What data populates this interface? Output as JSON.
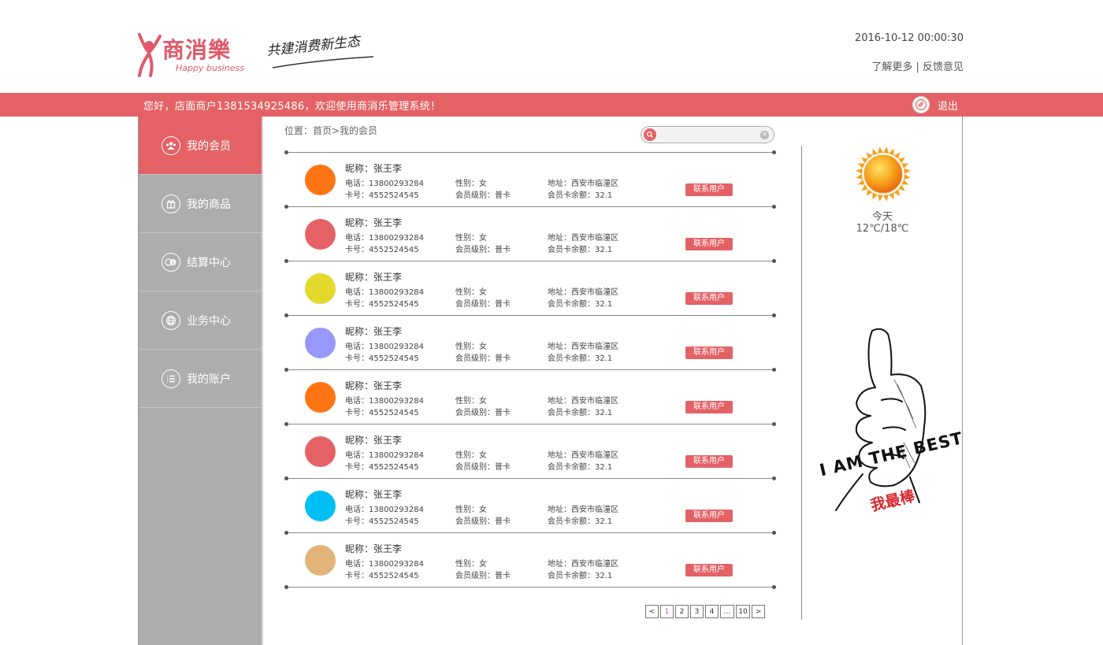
{
  "header": {
    "logo_text": "商消樂",
    "logo_subtext": "Happy business",
    "slogan": "共建消费新生态",
    "datetime": "2016-10-12 00:00:30",
    "link_more": "了解更多",
    "link_sep": " | ",
    "link_feedback": "反馈意见"
  },
  "topbar": {
    "welcome": "您好，店面商户13815349254​86，欢迎使用商消乐管理系统！",
    "logout": "退出"
  },
  "sidebar": {
    "items": [
      {
        "label": "我的会员",
        "icon": "members-icon",
        "active": true
      },
      {
        "label": "我的商品",
        "icon": "gift-icon",
        "active": false
      },
      {
        "label": "结算中心",
        "icon": "coins-icon",
        "active": false
      },
      {
        "label": "业务中心",
        "icon": "globe-icon",
        "active": false
      },
      {
        "label": "我的账户",
        "icon": "list-icon",
        "active": false
      }
    ]
  },
  "breadcrumb": "位置：首页>我的会员",
  "search": {
    "placeholder": "",
    "value": ""
  },
  "members": [
    {
      "color": "#ff7514",
      "nick": "昵称：张王李",
      "phone": "电话：13800293284",
      "card": "卡号：4552524545",
      "gender": "性别：女",
      "level": "会员级别：普卡",
      "address": "地址：西安市临潼区",
      "balance": "会员卡余额：32.1",
      "action": "联系用户"
    },
    {
      "color": "#e46266",
      "nick": "昵称：张王李",
      "phone": "电话：13800293284",
      "card": "卡号：4552524545",
      "gender": "性别：女",
      "level": "会员级别：普卡",
      "address": "地址：西安市临潼区",
      "balance": "会员卡余额：32.1",
      "action": "联系用户"
    },
    {
      "color": "#e3d92d",
      "nick": "昵称：张王李",
      "phone": "电话：13800293284",
      "card": "卡号：4552524545",
      "gender": "性别：女",
      "level": "会员级别：普卡",
      "address": "地址：西安市临潼区",
      "balance": "会员卡余额：32.1",
      "action": "联系用户"
    },
    {
      "color": "#9898fb",
      "nick": "昵称：张王李",
      "phone": "电话：13800293284",
      "card": "卡号：4552524545",
      "gender": "性别：女",
      "level": "会员级别：普卡",
      "address": "地址：西安市临潼区",
      "balance": "会员卡余额：32.1",
      "action": "联系用户"
    },
    {
      "color": "#ff7514",
      "nick": "昵称：张王李",
      "phone": "电话：13800293284",
      "card": "卡号：4552524545",
      "gender": "性别：女",
      "level": "会员级别：普卡",
      "address": "地址：西安市临潼区",
      "balance": "会员卡余额：32.1",
      "action": "联系用户"
    },
    {
      "color": "#e46266",
      "nick": "昵称：张王李",
      "phone": "电话：13800293284",
      "card": "卡号：4552524545",
      "gender": "性别：女",
      "level": "会员级别：普卡",
      "address": "地址：西安市临潼区",
      "balance": "会员卡余额：32.1",
      "action": "联系用户"
    },
    {
      "color": "#00bff5",
      "nick": "昵称：张王李",
      "phone": "电话：13800293284",
      "card": "卡号：4552524545",
      "gender": "性别：女",
      "level": "会员级别：普卡",
      "address": "地址：西安市临潼区",
      "balance": "会员卡余额：32.1",
      "action": "联系用户"
    },
    {
      "color": "#e1b57a",
      "nick": "昵称：张王李",
      "phone": "电话：13800293284",
      "card": "卡号：4552524545",
      "gender": "性别：女",
      "level": "会员级别：普卡",
      "address": "地址：西安市临潼区",
      "balance": "会员卡余额：32.1",
      "action": "联系用户"
    }
  ],
  "pager": {
    "prev": "<",
    "pages": [
      "1",
      "2",
      "3",
      "4",
      "...",
      "10"
    ],
    "current": "1",
    "next": ">"
  },
  "weather": {
    "label": "今天",
    "temp": "12℃/18℃",
    "icon": "sun-icon"
  },
  "promo": {
    "en": "I AM THE BEST",
    "cn": "我最棒",
    "icon": "thumbs-up-icon"
  },
  "colors": {
    "accent": "#e46266",
    "sidebar": "#adadad"
  }
}
